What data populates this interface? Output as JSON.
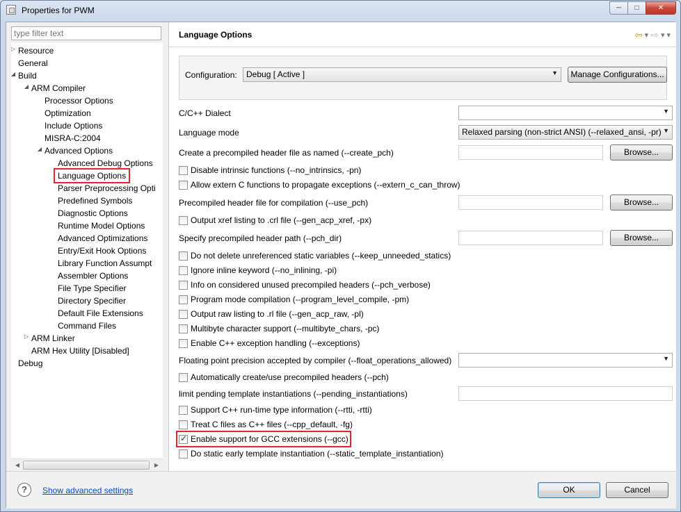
{
  "window": {
    "title": "Properties for PWM",
    "controls": {
      "minimize": "─",
      "maximize": "□",
      "close": "✕"
    }
  },
  "left": {
    "filter_placeholder": "type filter text",
    "tree": [
      {
        "label": "Resource",
        "indent": 0,
        "toggle": "▷"
      },
      {
        "label": "General",
        "indent": 0,
        "toggle": ""
      },
      {
        "label": "Build",
        "indent": 0,
        "toggle": "◢"
      },
      {
        "label": "ARM Compiler",
        "indent": 1,
        "toggle": "◢"
      },
      {
        "label": "Processor Options",
        "indent": 2,
        "toggle": ""
      },
      {
        "label": "Optimization",
        "indent": 2,
        "toggle": ""
      },
      {
        "label": "Include Options",
        "indent": 2,
        "toggle": ""
      },
      {
        "label": "MISRA-C:2004",
        "indent": 2,
        "toggle": ""
      },
      {
        "label": "Advanced Options",
        "indent": 2,
        "toggle": "◢"
      },
      {
        "label": "Advanced Debug Options",
        "indent": 3,
        "toggle": ""
      },
      {
        "label": "Language Options",
        "indent": 3,
        "toggle": "",
        "selected": true
      },
      {
        "label": "Parser Preprocessing Opti",
        "indent": 3,
        "toggle": ""
      },
      {
        "label": "Predefined Symbols",
        "indent": 3,
        "toggle": ""
      },
      {
        "label": "Diagnostic Options",
        "indent": 3,
        "toggle": ""
      },
      {
        "label": "Runtime Model Options",
        "indent": 3,
        "toggle": ""
      },
      {
        "label": "Advanced Optimizations",
        "indent": 3,
        "toggle": ""
      },
      {
        "label": "Entry/Exit Hook Options",
        "indent": 3,
        "toggle": ""
      },
      {
        "label": "Library Function Assumpt",
        "indent": 3,
        "toggle": ""
      },
      {
        "label": "Assembler Options",
        "indent": 3,
        "toggle": ""
      },
      {
        "label": "File Type Specifier",
        "indent": 3,
        "toggle": ""
      },
      {
        "label": "Directory Specifier",
        "indent": 3,
        "toggle": ""
      },
      {
        "label": "Default File Extensions",
        "indent": 3,
        "toggle": ""
      },
      {
        "label": "Command Files",
        "indent": 3,
        "toggle": ""
      },
      {
        "label": "ARM Linker",
        "indent": 1,
        "toggle": "▷"
      },
      {
        "label": "ARM Hex Utility  [Disabled]",
        "indent": 1,
        "toggle": ""
      },
      {
        "label": "Debug",
        "indent": 0,
        "toggle": ""
      }
    ]
  },
  "right": {
    "title": "Language Options",
    "configuration": {
      "label": "Configuration:",
      "value": "Debug  [ Active ]",
      "manage_label": "Manage Configurations..."
    },
    "browse_label": "Browse...",
    "rows": [
      {
        "kind": "combo",
        "label": "C/C++ Dialect",
        "value": ""
      },
      {
        "kind": "combo",
        "label": "Language mode",
        "value": "Relaxed parsing (non-strict ANSI) (--relaxed_ansi, -pr)"
      },
      {
        "kind": "text-browse",
        "label": "Create a precompiled header file as named (--create_pch)",
        "value": ""
      },
      {
        "kind": "checkbox",
        "label": "Disable intrinsic functions (--no_intrinsics, -pn)",
        "checked": false
      },
      {
        "kind": "checkbox",
        "label": "Allow extern C functions to propagate exceptions (--extern_c_can_throw)",
        "checked": false
      },
      {
        "kind": "text-browse",
        "label": "Precompiled header file for compilation (--use_pch)",
        "value": ""
      },
      {
        "kind": "checkbox",
        "label": "Output xref listing to .crl file (--gen_acp_xref, -px)",
        "checked": false
      },
      {
        "kind": "text-browse",
        "label": "Specify precompiled header path (--pch_dir)",
        "value": ""
      },
      {
        "kind": "checkbox",
        "label": "Do not delete unreferenced static variables (--keep_unneeded_statics)",
        "checked": false
      },
      {
        "kind": "checkbox",
        "label": "Ignore inline keyword (--no_inlining, -pi)",
        "checked": false
      },
      {
        "kind": "checkbox",
        "label": "Info on considered  unused precompiled headers (--pch_verbose)",
        "checked": false
      },
      {
        "kind": "checkbox",
        "label": "Program mode compilation (--program_level_compile, -pm)",
        "checked": false
      },
      {
        "kind": "checkbox",
        "label": "Output raw listing to .rl file (--gen_acp_raw, -pl)",
        "checked": false
      },
      {
        "kind": "checkbox",
        "label": "Multibyte character support (--multibyte_chars, -pc)",
        "checked": false
      },
      {
        "kind": "checkbox",
        "label": "Enable C++ exception handling (--exceptions)",
        "checked": false
      },
      {
        "kind": "combo",
        "label": "Floating point precision accepted by compiler (--float_operations_allowed)",
        "value": ""
      },
      {
        "kind": "checkbox",
        "label": "Automatically create/use precompiled headers (--pch)",
        "checked": false
      },
      {
        "kind": "text",
        "label": "limit pending template instantiations (--pending_instantiations)",
        "value": ""
      },
      {
        "kind": "checkbox",
        "label": "Support C++ run-time type information (--rtti, -rtti)",
        "checked": false
      },
      {
        "kind": "checkbox",
        "label": "Treat C files as C++ files (--cpp_default, -fg)",
        "checked": false
      },
      {
        "kind": "checkbox",
        "label": "Enable support for GCC extensions (--gcc)",
        "checked": true,
        "highlight": true
      },
      {
        "kind": "checkbox",
        "label": "Do static early template instantiation (--static_template_instantiation)",
        "checked": false
      }
    ]
  },
  "bottom": {
    "help_icon": "?",
    "advanced_link": "Show advanced settings",
    "ok_label": "OK",
    "cancel_label": "Cancel"
  },
  "colors": {
    "highlight": "#e0262b",
    "link": "#0b4ac7"
  }
}
